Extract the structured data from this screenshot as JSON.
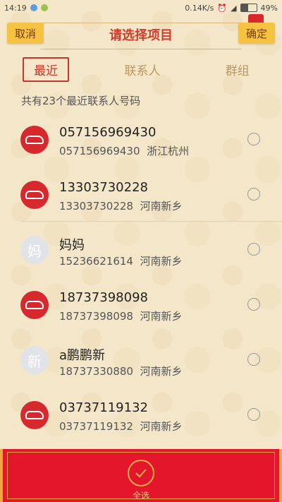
{
  "status": {
    "time": "14:19",
    "speed": "0.14K/s",
    "battery": "49%"
  },
  "header": {
    "cancel": "取消",
    "title": "请选择项目",
    "confirm": "确定"
  },
  "tabs": [
    {
      "label": "最近",
      "active": true
    },
    {
      "label": "联系人",
      "active": false
    },
    {
      "label": "群组",
      "active": false
    }
  ],
  "summary": "共有23个最近联系人号码",
  "contacts": [
    {
      "avatar": "car-icon",
      "avatar_text": "",
      "name": "057156969430",
      "number": "057156969430",
      "region": "浙江杭州"
    },
    {
      "avatar": "car-icon",
      "avatar_text": "",
      "name": "13303730228",
      "number": "13303730228",
      "region": "河南新乡"
    },
    {
      "avatar": "letter",
      "avatar_text": "妈",
      "name": "妈妈",
      "number": "15236621614",
      "region": "河南新乡"
    },
    {
      "avatar": "car-icon",
      "avatar_text": "",
      "name": "18737398098",
      "number": "18737398098",
      "region": "河南新乡"
    },
    {
      "avatar": "letter",
      "avatar_text": "新",
      "name": "a鹏鹏新",
      "number": "18737330880",
      "region": "河南新乡"
    },
    {
      "avatar": "car-icon",
      "avatar_text": "",
      "name": "03737119132",
      "number": "03737119132",
      "region": "河南新乡"
    }
  ],
  "footer": {
    "select_all": "全选"
  },
  "colors": {
    "accent": "#e4162b",
    "gold": "#f6c244",
    "background": "#f4e7c9"
  }
}
